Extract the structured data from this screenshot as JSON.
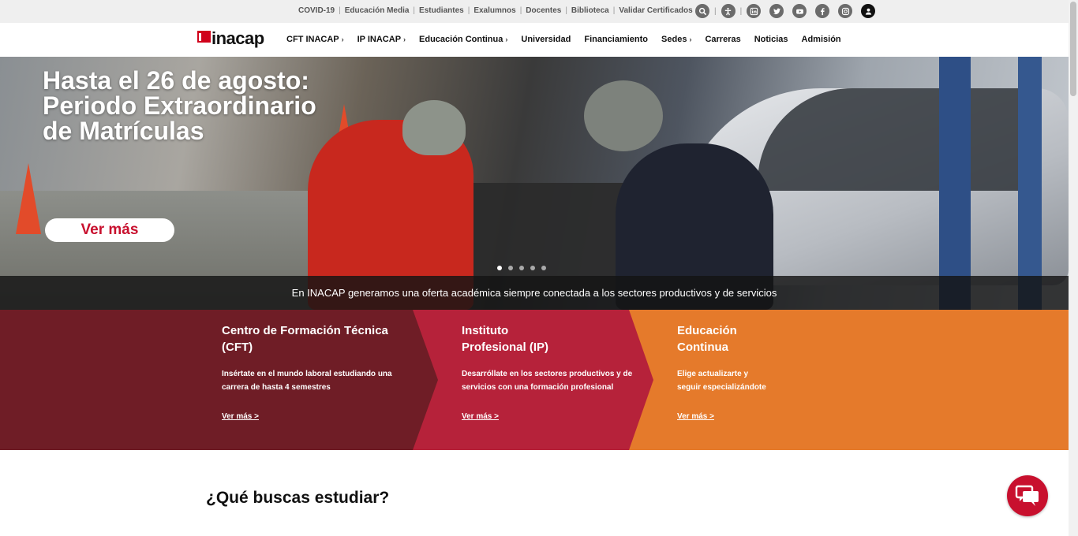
{
  "topbar": {
    "links": [
      "COVID-19",
      "Educación Media",
      "Estudiantes",
      "Exalumnos",
      "Docentes",
      "Biblioteca",
      "Validar Certificados"
    ],
    "icons": [
      "search-icon",
      "accessibility-icon",
      "linkedin-icon",
      "twitter-icon",
      "youtube-icon",
      "facebook-icon",
      "instagram-icon",
      "user-icon"
    ]
  },
  "nav": {
    "logo": "inacap",
    "items": [
      {
        "label": "CFT INACAP",
        "chevron": "›"
      },
      {
        "label": "IP INACAP",
        "chevron": "›"
      },
      {
        "label": "Educación Continua",
        "chevron": "›"
      },
      {
        "label": "Universidad",
        "chevron": ""
      },
      {
        "label": "Financiamiento",
        "chevron": ""
      },
      {
        "label": "Sedes",
        "chevron": "›"
      },
      {
        "label": "Carreras",
        "chevron": ""
      },
      {
        "label": "Noticias",
        "chevron": ""
      },
      {
        "label": "Admisión",
        "chevron": ""
      }
    ]
  },
  "hero": {
    "title_lines": [
      "Hasta el 26 de agosto:",
      "Periodo Extraordinario",
      "de Matrículas"
    ],
    "button_label": "Ver más",
    "slides": 5,
    "active_slide": 1,
    "strip_text": "En INACAP generamos una oferta académica siempre conectada a los sectores productivos y de servicios"
  },
  "panels": [
    {
      "title_lines": [
        "Centro de Formación Técnica",
        "(CFT)"
      ],
      "desc_lines": [
        "Insértate en el mundo laboral estudiando una",
        "carrera de hasta 4 semestres"
      ],
      "link": "Ver más >",
      "color": "#6f1d26"
    },
    {
      "title_lines": [
        "Instituto",
        "Profesional (IP)"
      ],
      "desc_lines": [
        "Desarróllate en los sectores productivos y de",
        "servicios con una formación profesional"
      ],
      "link": "Ver más >",
      "color": "#b6223a"
    },
    {
      "title_lines": [
        "Educación",
        "Continua"
      ],
      "desc_lines": [
        "Elige actualizarte y",
        "seguir especializándote"
      ],
      "link": "Ver más >",
      "color": "#e57a2b"
    }
  ],
  "section": {
    "title": "¿Qué buscas estudiar?"
  },
  "colors": {
    "brand_red": "#c8102e",
    "dark_bar": "#141414"
  }
}
